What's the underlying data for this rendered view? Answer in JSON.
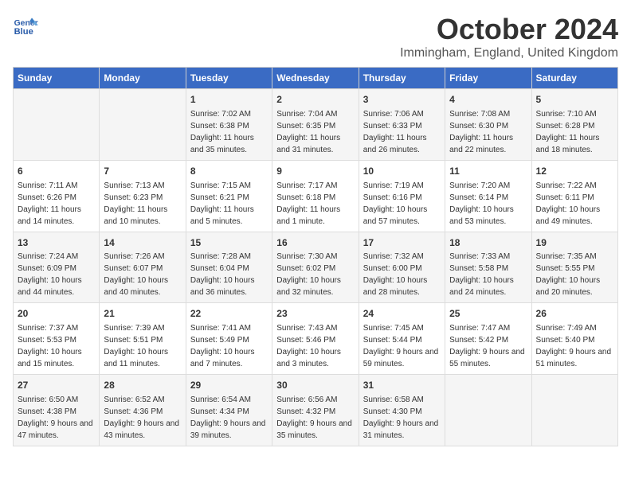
{
  "header": {
    "logo_general": "General",
    "logo_blue": "Blue",
    "month_title": "October 2024",
    "location": "Immingham, England, United Kingdom"
  },
  "days_of_week": [
    "Sunday",
    "Monday",
    "Tuesday",
    "Wednesday",
    "Thursday",
    "Friday",
    "Saturday"
  ],
  "weeks": [
    [
      {
        "num": "",
        "sunrise": "",
        "sunset": "",
        "daylight": ""
      },
      {
        "num": "",
        "sunrise": "",
        "sunset": "",
        "daylight": ""
      },
      {
        "num": "1",
        "sunrise": "Sunrise: 7:02 AM",
        "sunset": "Sunset: 6:38 PM",
        "daylight": "Daylight: 11 hours and 35 minutes."
      },
      {
        "num": "2",
        "sunrise": "Sunrise: 7:04 AM",
        "sunset": "Sunset: 6:35 PM",
        "daylight": "Daylight: 11 hours and 31 minutes."
      },
      {
        "num": "3",
        "sunrise": "Sunrise: 7:06 AM",
        "sunset": "Sunset: 6:33 PM",
        "daylight": "Daylight: 11 hours and 26 minutes."
      },
      {
        "num": "4",
        "sunrise": "Sunrise: 7:08 AM",
        "sunset": "Sunset: 6:30 PM",
        "daylight": "Daylight: 11 hours and 22 minutes."
      },
      {
        "num": "5",
        "sunrise": "Sunrise: 7:10 AM",
        "sunset": "Sunset: 6:28 PM",
        "daylight": "Daylight: 11 hours and 18 minutes."
      }
    ],
    [
      {
        "num": "6",
        "sunrise": "Sunrise: 7:11 AM",
        "sunset": "Sunset: 6:26 PM",
        "daylight": "Daylight: 11 hours and 14 minutes."
      },
      {
        "num": "7",
        "sunrise": "Sunrise: 7:13 AM",
        "sunset": "Sunset: 6:23 PM",
        "daylight": "Daylight: 11 hours and 10 minutes."
      },
      {
        "num": "8",
        "sunrise": "Sunrise: 7:15 AM",
        "sunset": "Sunset: 6:21 PM",
        "daylight": "Daylight: 11 hours and 5 minutes."
      },
      {
        "num": "9",
        "sunrise": "Sunrise: 7:17 AM",
        "sunset": "Sunset: 6:18 PM",
        "daylight": "Daylight: 11 hours and 1 minute."
      },
      {
        "num": "10",
        "sunrise": "Sunrise: 7:19 AM",
        "sunset": "Sunset: 6:16 PM",
        "daylight": "Daylight: 10 hours and 57 minutes."
      },
      {
        "num": "11",
        "sunrise": "Sunrise: 7:20 AM",
        "sunset": "Sunset: 6:14 PM",
        "daylight": "Daylight: 10 hours and 53 minutes."
      },
      {
        "num": "12",
        "sunrise": "Sunrise: 7:22 AM",
        "sunset": "Sunset: 6:11 PM",
        "daylight": "Daylight: 10 hours and 49 minutes."
      }
    ],
    [
      {
        "num": "13",
        "sunrise": "Sunrise: 7:24 AM",
        "sunset": "Sunset: 6:09 PM",
        "daylight": "Daylight: 10 hours and 44 minutes."
      },
      {
        "num": "14",
        "sunrise": "Sunrise: 7:26 AM",
        "sunset": "Sunset: 6:07 PM",
        "daylight": "Daylight: 10 hours and 40 minutes."
      },
      {
        "num": "15",
        "sunrise": "Sunrise: 7:28 AM",
        "sunset": "Sunset: 6:04 PM",
        "daylight": "Daylight: 10 hours and 36 minutes."
      },
      {
        "num": "16",
        "sunrise": "Sunrise: 7:30 AM",
        "sunset": "Sunset: 6:02 PM",
        "daylight": "Daylight: 10 hours and 32 minutes."
      },
      {
        "num": "17",
        "sunrise": "Sunrise: 7:32 AM",
        "sunset": "Sunset: 6:00 PM",
        "daylight": "Daylight: 10 hours and 28 minutes."
      },
      {
        "num": "18",
        "sunrise": "Sunrise: 7:33 AM",
        "sunset": "Sunset: 5:58 PM",
        "daylight": "Daylight: 10 hours and 24 minutes."
      },
      {
        "num": "19",
        "sunrise": "Sunrise: 7:35 AM",
        "sunset": "Sunset: 5:55 PM",
        "daylight": "Daylight: 10 hours and 20 minutes."
      }
    ],
    [
      {
        "num": "20",
        "sunrise": "Sunrise: 7:37 AM",
        "sunset": "Sunset: 5:53 PM",
        "daylight": "Daylight: 10 hours and 15 minutes."
      },
      {
        "num": "21",
        "sunrise": "Sunrise: 7:39 AM",
        "sunset": "Sunset: 5:51 PM",
        "daylight": "Daylight: 10 hours and 11 minutes."
      },
      {
        "num": "22",
        "sunrise": "Sunrise: 7:41 AM",
        "sunset": "Sunset: 5:49 PM",
        "daylight": "Daylight: 10 hours and 7 minutes."
      },
      {
        "num": "23",
        "sunrise": "Sunrise: 7:43 AM",
        "sunset": "Sunset: 5:46 PM",
        "daylight": "Daylight: 10 hours and 3 minutes."
      },
      {
        "num": "24",
        "sunrise": "Sunrise: 7:45 AM",
        "sunset": "Sunset: 5:44 PM",
        "daylight": "Daylight: 9 hours and 59 minutes."
      },
      {
        "num": "25",
        "sunrise": "Sunrise: 7:47 AM",
        "sunset": "Sunset: 5:42 PM",
        "daylight": "Daylight: 9 hours and 55 minutes."
      },
      {
        "num": "26",
        "sunrise": "Sunrise: 7:49 AM",
        "sunset": "Sunset: 5:40 PM",
        "daylight": "Daylight: 9 hours and 51 minutes."
      }
    ],
    [
      {
        "num": "27",
        "sunrise": "Sunrise: 6:50 AM",
        "sunset": "Sunset: 4:38 PM",
        "daylight": "Daylight: 9 hours and 47 minutes."
      },
      {
        "num": "28",
        "sunrise": "Sunrise: 6:52 AM",
        "sunset": "Sunset: 4:36 PM",
        "daylight": "Daylight: 9 hours and 43 minutes."
      },
      {
        "num": "29",
        "sunrise": "Sunrise: 6:54 AM",
        "sunset": "Sunset: 4:34 PM",
        "daylight": "Daylight: 9 hours and 39 minutes."
      },
      {
        "num": "30",
        "sunrise": "Sunrise: 6:56 AM",
        "sunset": "Sunset: 4:32 PM",
        "daylight": "Daylight: 9 hours and 35 minutes."
      },
      {
        "num": "31",
        "sunrise": "Sunrise: 6:58 AM",
        "sunset": "Sunset: 4:30 PM",
        "daylight": "Daylight: 9 hours and 31 minutes."
      },
      {
        "num": "",
        "sunrise": "",
        "sunset": "",
        "daylight": ""
      },
      {
        "num": "",
        "sunrise": "",
        "sunset": "",
        "daylight": ""
      }
    ]
  ]
}
